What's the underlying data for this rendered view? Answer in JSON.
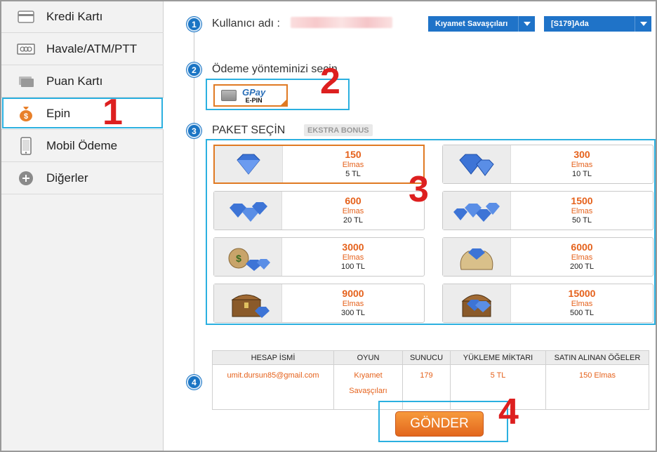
{
  "sidebar": {
    "items": [
      {
        "label": "Kredi Kartı",
        "icon": "credit-card-icon"
      },
      {
        "label": "Havale/ATM/PTT",
        "icon": "bank-transfer-icon"
      },
      {
        "label": "Puan Kartı",
        "icon": "point-card-icon"
      },
      {
        "label": "Epin",
        "icon": "money-bag-icon",
        "active": true
      },
      {
        "label": "Mobil Ödeme",
        "icon": "mobile-phone-icon"
      },
      {
        "label": "Diğerler",
        "icon": "plus-circle-icon"
      }
    ]
  },
  "steps": {
    "s1": {
      "num": "1",
      "title": "Kullanıcı adı :"
    },
    "s2": {
      "num": "2",
      "title": "Ödeme yönteminizi seçin"
    },
    "s3": {
      "num": "3",
      "title": "PAKET SEÇİN",
      "badge": "EKSTRA BONUS"
    },
    "s4": {
      "num": "4"
    }
  },
  "selects": {
    "game": "Kıyamet Savaşçıları",
    "server": "[S179]Ada"
  },
  "payment_method": {
    "brand": "GPay",
    "sub": "E-PIN",
    "selected": true
  },
  "packages": [
    {
      "amount": "150",
      "unit": "Elmas",
      "price": "5 TL",
      "icon": "diamond-icon",
      "selected": true
    },
    {
      "amount": "300",
      "unit": "Elmas",
      "price": "10 TL",
      "icon": "diamond-pile-icon"
    },
    {
      "amount": "600",
      "unit": "Elmas",
      "price": "20 TL",
      "icon": "diamonds-icon"
    },
    {
      "amount": "1500",
      "unit": "Elmas",
      "price": "50 TL",
      "icon": "diamonds-icon"
    },
    {
      "amount": "3000",
      "unit": "Elmas",
      "price": "100 TL",
      "icon": "money-bag-diamonds-icon"
    },
    {
      "amount": "6000",
      "unit": "Elmas",
      "price": "200 TL",
      "icon": "sack-diamonds-icon"
    },
    {
      "amount": "9000",
      "unit": "Elmas",
      "price": "300 TL",
      "icon": "treasure-chest-icon"
    },
    {
      "amount": "15000",
      "unit": "Elmas",
      "price": "500 TL",
      "icon": "treasure-chest-icon"
    }
  ],
  "summary": {
    "headers": [
      "HESAP İSMİ",
      "OYUN",
      "SUNUCU",
      "YÜKLEME MİKTARI",
      "SATIN ALINAN ÖĞELER"
    ],
    "row": [
      "umit.dursun85@gmail.com",
      "Kıyamet Savaşçıları",
      "179",
      "5 TL",
      "150 Elmas"
    ]
  },
  "submit_label": "GÖNDER",
  "annotations": [
    "1",
    "2",
    "3",
    "4"
  ],
  "colors": {
    "accent_blue": "#1f73c8",
    "orange": "#e5611b",
    "highlight": "#2bb0e0",
    "annotation_red": "#dd1f1f"
  }
}
